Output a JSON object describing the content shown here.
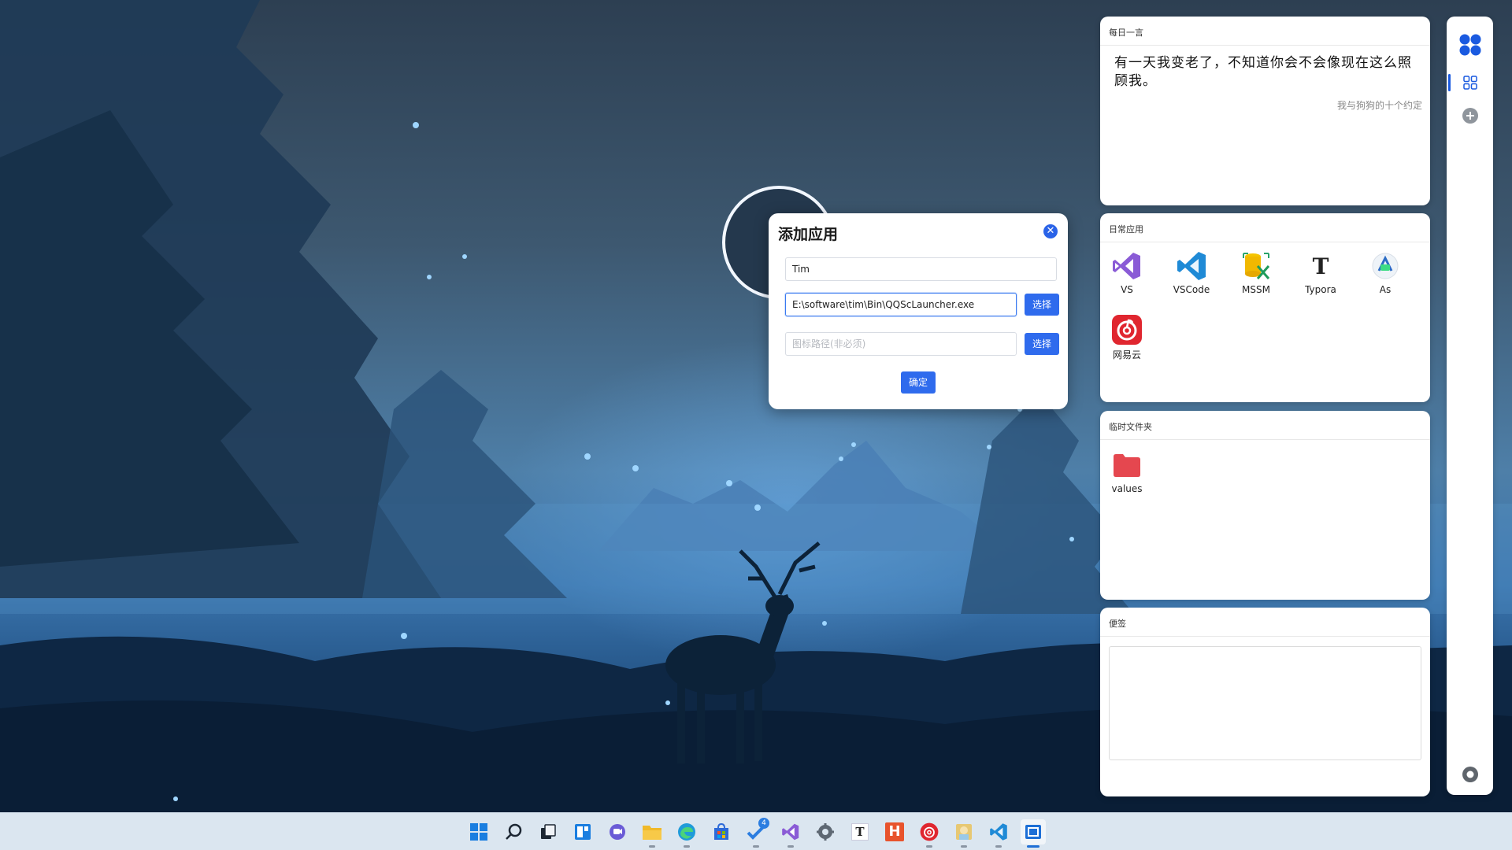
{
  "dialog": {
    "title": "添加应用",
    "name_value": "Tim",
    "path_value": "E:\\software\\tim\\Bin\\QQScLauncher.exe",
    "path_button": "选择",
    "icon_placeholder": "图标路径(非必须)",
    "icon_button": "选择",
    "confirm_button": "确定"
  },
  "widgets": {
    "quote": {
      "header": "每日一言",
      "text": "有一天我变老了，不知道你会不会像现在这么照顾我。",
      "source": "我与狗狗的十个约定"
    },
    "apps": {
      "header": "日常应用",
      "items": [
        {
          "label": "VS",
          "icon": "visual-studio-icon"
        },
        {
          "label": "VSCode",
          "icon": "vscode-icon"
        },
        {
          "label": "MSSM",
          "icon": "mssm-icon"
        },
        {
          "label": "Typora",
          "icon": "typora-icon"
        },
        {
          "label": "As",
          "icon": "android-studio-icon"
        },
        {
          "label": "网易云",
          "icon": "netease-music-icon"
        }
      ]
    },
    "temp_folder": {
      "header": "临时文件夹",
      "items": [
        {
          "label": "values",
          "icon": "folder-icon"
        }
      ]
    },
    "notes": {
      "header": "便签"
    }
  },
  "rail": {
    "badge_count": "4"
  },
  "colors": {
    "accent": "#2f6bed",
    "rail_active": "#1a5ae0",
    "netease_red": "#e0262f",
    "folder_red": "#e5474f"
  }
}
